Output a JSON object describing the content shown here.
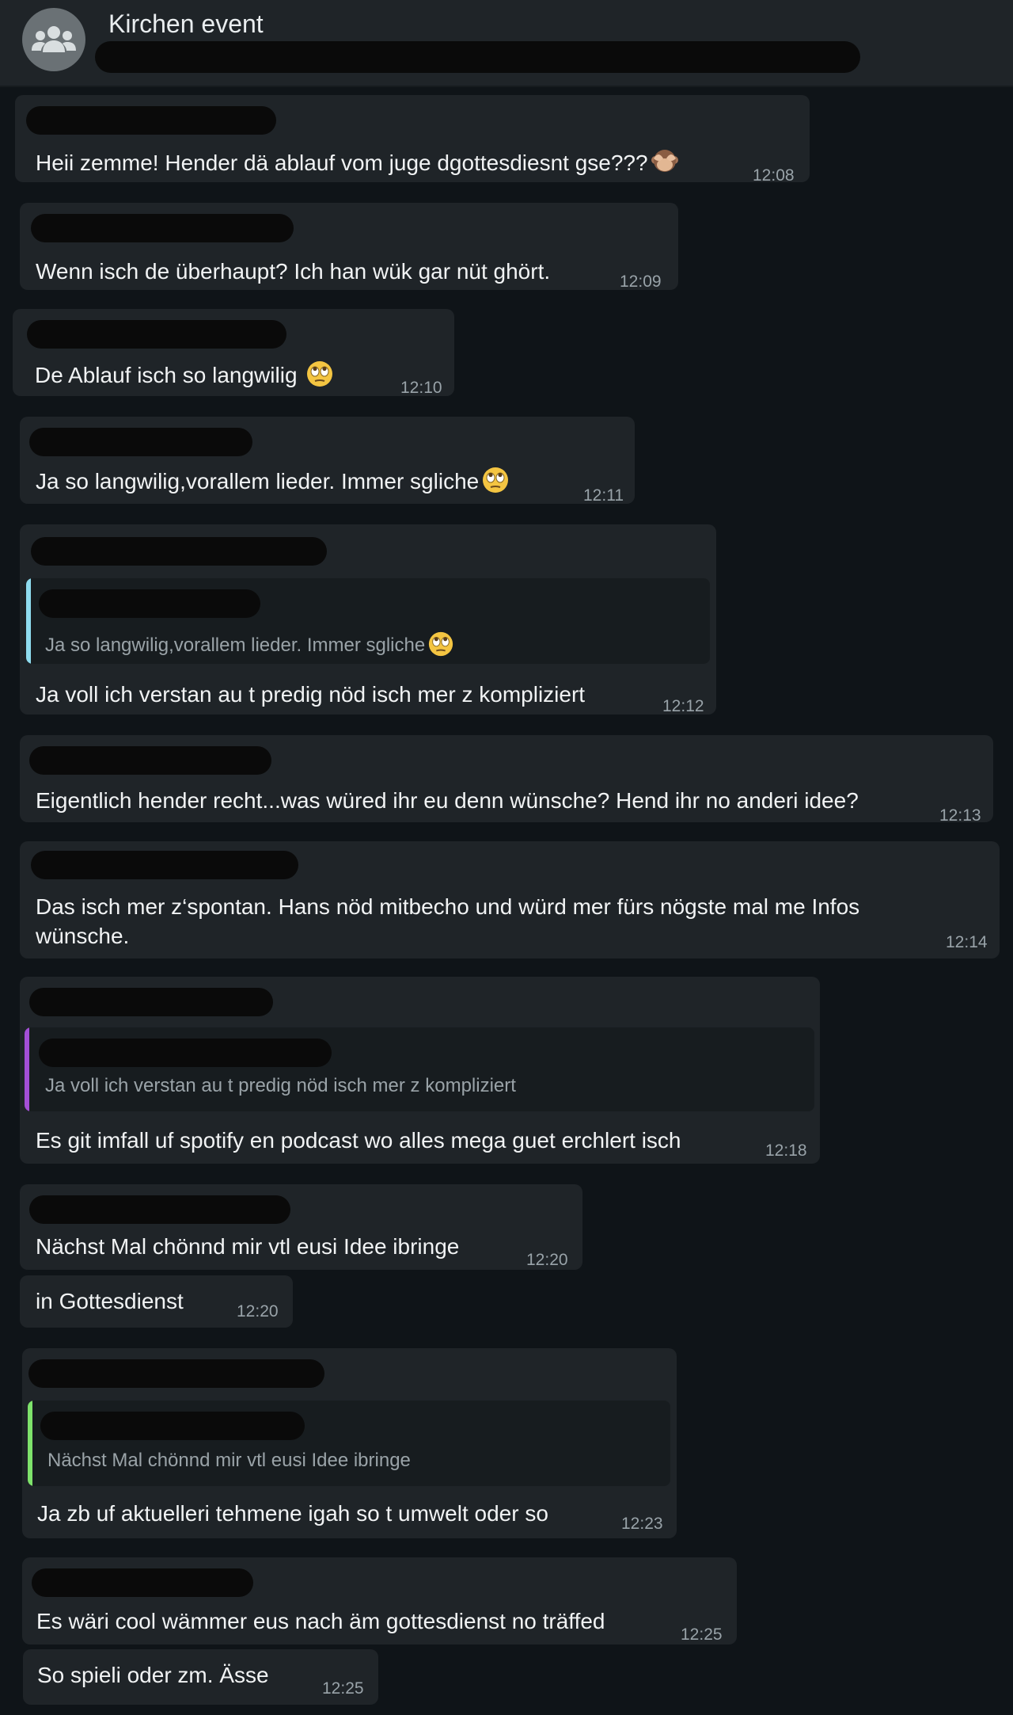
{
  "header": {
    "chat_title": "Kirchen event",
    "avatar_icon": "group-icon"
  },
  "messages": [
    {
      "text": "Heii zemme! Hender dä ablauf vom juge dgottesdiesnt gse???",
      "emoji": "see-no-evil-monkey-icon",
      "time": "12:08"
    },
    {
      "text": "Wenn isch de überhaupt? Ich han wük gar nüt ghört.",
      "time": "12:09"
    },
    {
      "text": "De Ablauf isch so langwilig",
      "emoji": "eye-roll-face-icon",
      "time": "12:10"
    },
    {
      "text": "Ja so langwilig,vorallem lieder. Immer sgliche",
      "emoji": "eye-roll-face-icon",
      "time": "12:11"
    },
    {
      "quote": "Ja so langwilig,vorallem lieder. Immer sgliche",
      "quote_emoji": "eye-roll-face-icon",
      "quote_color": "#8fdcef",
      "text": "Ja voll ich verstan au t predig nöd isch mer z kompliziert",
      "time": "12:12"
    },
    {
      "text": "Eigentlich hender recht...was würed ihr eu denn wünsche? Hend ihr no anderi idee?",
      "time": "12:13"
    },
    {
      "text": "Das isch mer z‘spontan. Hans nöd mitbecho und würd mer fürs nögste mal me Infos\nwünsche.",
      "time": "12:14"
    },
    {
      "quote": "Ja voll ich verstan au t predig nöd isch mer z kompliziert",
      "quote_color": "#a44fd6",
      "text": "Es git imfall uf spotify en podcast wo alles mega guet erchlert isch",
      "time": "12:18"
    },
    {
      "text": "Nächst Mal chönnd mir vtl eusi Idee ibringe",
      "time": "12:20"
    },
    {
      "text": "in Gottesdienst",
      "time": "12:20"
    },
    {
      "quote": "Nächst Mal chönnd mir vtl eusi Idee ibringe",
      "quote_color": "#7ee26b",
      "text": "Ja zb uf aktuelleri tehmene igah so t umwelt oder so",
      "time": "12:23"
    },
    {
      "text": "Es wäri cool wämmer eus nach äm gottesdienst no träffed",
      "time": "12:25"
    },
    {
      "text": "So spieli oder zm. Ässe",
      "time": "12:25"
    }
  ]
}
